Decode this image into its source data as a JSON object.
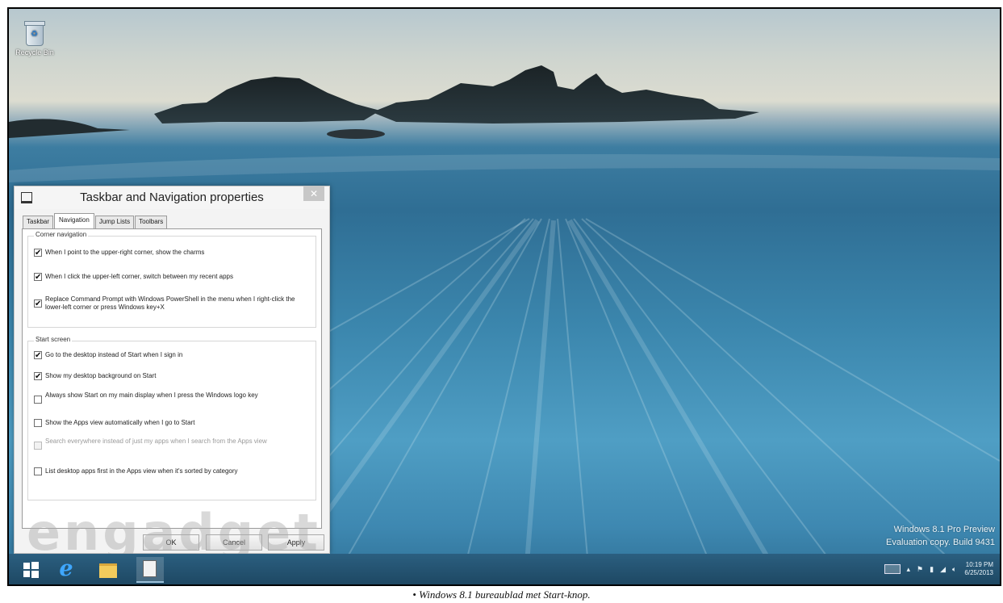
{
  "desktop": {
    "recycle_bin_label": "Recycle Bin",
    "windows_version": "Windows 8.1 Pro Preview",
    "evaluation_copy": "Evaluation copy. Build 9431"
  },
  "dialog": {
    "title": "Taskbar and Navigation properties",
    "close_glyph": "✕",
    "tabs": [
      "Taskbar",
      "Navigation",
      "Jump Lists",
      "Toolbars"
    ],
    "active_tab": "Navigation",
    "corner_navigation": {
      "legend": "Corner navigation",
      "options": [
        {
          "label": "When I point to the upper-right corner, show the charms",
          "checked": true
        },
        {
          "label": "When I click the upper-left corner, switch between my recent apps",
          "checked": true
        },
        {
          "label": "Replace Command Prompt with Windows PowerShell in the menu when I right-click the lower-left corner or press Windows key+X",
          "checked": true
        }
      ]
    },
    "start_screen": {
      "legend": "Start screen",
      "options": [
        {
          "label": "Go to the desktop instead of Start when I sign in",
          "checked": true
        },
        {
          "label": "Show my desktop background on Start",
          "checked": true
        },
        {
          "label": "Always show Start on my main display when I press the Windows logo key",
          "checked": false
        },
        {
          "label": "Show the Apps view automatically when I go to Start",
          "checked": false
        },
        {
          "label": "Search everywhere instead of just my apps when I search from the Apps view",
          "checked": false,
          "disabled": true
        },
        {
          "label": "List desktop apps first in the Apps view when it's sorted by category",
          "checked": false
        }
      ]
    },
    "buttons": {
      "ok": "OK",
      "cancel": "Cancel",
      "apply": "Apply"
    }
  },
  "watermark": "engadget",
  "taskbar": {
    "icons": [
      "windows-logo-icon",
      "internet-explorer-icon",
      "file-explorer-icon",
      "properties-window-icon"
    ],
    "tray": {
      "chevron": "▴",
      "time": "10:19 PM",
      "date": "6/25/2013"
    }
  },
  "caption": "Windows 8.1 bureaublad met Start-knop.",
  "colors": {
    "taskbar": "#24526f",
    "dialog_bg": "#f3f3f3",
    "accent": "#3fa7ff"
  }
}
